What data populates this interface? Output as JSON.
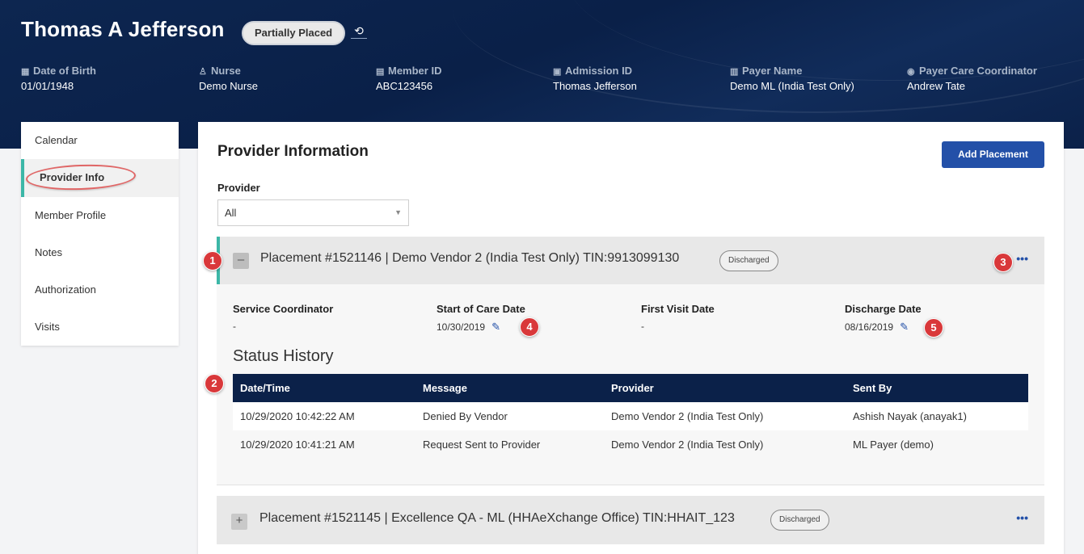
{
  "header": {
    "patient_name": "Thomas A Jefferson",
    "status": "Partially Placed",
    "fields": [
      {
        "icon": "calendar-icon",
        "label": "Date of Birth",
        "value": "01/01/1948"
      },
      {
        "icon": "user-icon",
        "label": "Nurse",
        "value": "Demo Nurse"
      },
      {
        "icon": "id-badge-icon",
        "label": "Member ID",
        "value": "ABC123456"
      },
      {
        "icon": "id-card-icon",
        "label": "Admission ID",
        "value": "Thomas Jefferson"
      },
      {
        "icon": "document-icon",
        "label": "Payer Name",
        "value": "Demo ML (India Test Only)"
      },
      {
        "icon": "user-circle-icon",
        "label": "Payer Care Coordinator",
        "value": "Andrew Tate"
      }
    ]
  },
  "sidebar": {
    "items": [
      {
        "label": "Calendar",
        "active": false
      },
      {
        "label": "Provider Info",
        "active": true
      },
      {
        "label": "Member Profile",
        "active": false
      },
      {
        "label": "Notes",
        "active": false
      },
      {
        "label": "Authorization",
        "active": false
      },
      {
        "label": "Visits",
        "active": false
      }
    ]
  },
  "main": {
    "title": "Provider Information",
    "add_button": "Add Placement",
    "provider_label": "Provider",
    "provider_value": "All",
    "placements": [
      {
        "toggle": "–",
        "title": "Placement #1521146 | Demo Vendor 2 (India Test Only) TIN:9913099130",
        "badge": "Discharged",
        "more": "•••"
      },
      {
        "toggle": "+",
        "title": "Placement #1521145 | Excellence QA - ML (HHAeXchange Office) TIN:HHAIT_123",
        "badge": "Discharged",
        "more": "•••"
      }
    ],
    "details": {
      "service_coordinator_label": "Service Coordinator",
      "service_coordinator_value": "-",
      "start_of_care_label": "Start of Care Date",
      "start_of_care_value": "10/30/2019",
      "first_visit_label": "First Visit Date",
      "first_visit_value": "-",
      "discharge_label": "Discharge Date",
      "discharge_value": "08/16/2019"
    },
    "status_history": {
      "title": "Status History",
      "columns": [
        "Date/Time",
        "Message",
        "Provider",
        "Sent By"
      ],
      "rows": [
        [
          "10/29/2020 10:42:22 AM",
          "Denied By Vendor",
          "Demo Vendor 2 (India Test Only)",
          "Ashish Nayak (anayak1)"
        ],
        [
          "10/29/2020 10:41:21 AM",
          "Request Sent to Provider",
          "Demo Vendor 2 (India Test Only)",
          "ML Payer (demo)"
        ]
      ]
    }
  },
  "annotations": [
    "1",
    "2",
    "3",
    "4",
    "5"
  ],
  "colors": {
    "header_bg": "#0b2149",
    "accent": "#3cb7a7",
    "primary_button": "#2350a8",
    "marker": "#d9383a"
  }
}
